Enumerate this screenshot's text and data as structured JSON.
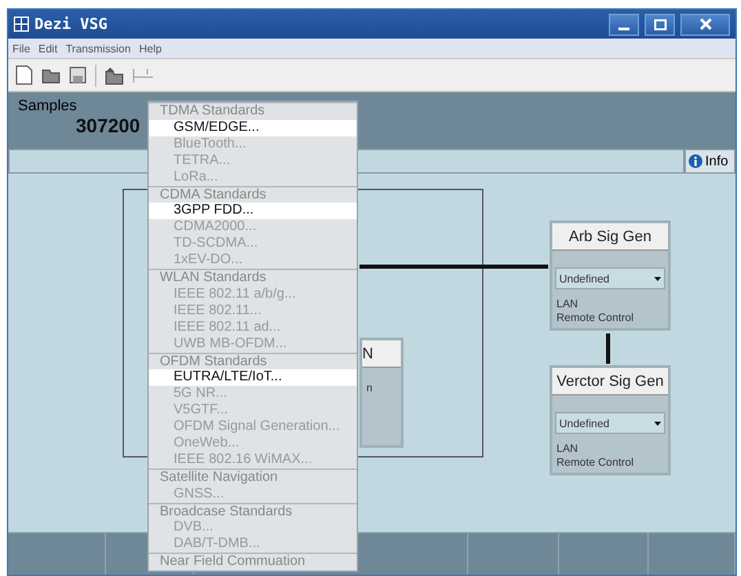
{
  "window": {
    "title": "Dezi VSG"
  },
  "menu_bar": [
    "File",
    "Edit",
    "Transmission",
    "Help"
  ],
  "samples": {
    "label": "Samples",
    "value": "307200"
  },
  "info_button": "Info",
  "partial_block": {
    "title": "N",
    "line": "n"
  },
  "blocks": [
    {
      "title": "Arb Sig Gen",
      "select": "Undefined",
      "lines": [
        "LAN",
        "Remote Control"
      ]
    },
    {
      "title": "Verctor Sig Gen",
      "select": "Undefined",
      "lines": [
        "LAN",
        "Remote Control"
      ]
    }
  ],
  "dropdown_menu": [
    {
      "header": "TDMA Standards",
      "items": [
        {
          "label": "GSM/EDGE...",
          "disabled": false
        },
        {
          "label": "BlueTooth...",
          "disabled": true
        },
        {
          "label": "TETRA...",
          "disabled": true
        },
        {
          "label": "LoRa...",
          "disabled": true
        }
      ]
    },
    {
      "header": "CDMA Standards",
      "items": [
        {
          "label": "3GPP FDD...",
          "disabled": false
        },
        {
          "label": "CDMA2000...",
          "disabled": true
        },
        {
          "label": "TD-SCDMA...",
          "disabled": true
        },
        {
          "label": "1xEV-DO...",
          "disabled": true
        }
      ]
    },
    {
      "header": "WLAN Standards",
      "items": [
        {
          "label": "IEEE 802.11 a/b/g...",
          "disabled": true
        },
        {
          "label": "IEEE 802.11...",
          "disabled": true
        },
        {
          "label": "IEEE 802.11 ad...",
          "disabled": true
        },
        {
          "label": "UWB MB-OFDM...",
          "disabled": true
        }
      ]
    },
    {
      "header": "OFDM Standards",
      "items": [
        {
          "label": "EUTRA/LTE/IoT...",
          "disabled": false
        },
        {
          "label": "5G NR...",
          "disabled": true
        },
        {
          "label": "V5GTF...",
          "disabled": true
        },
        {
          "label": "OFDM Signal Generation...",
          "disabled": true
        },
        {
          "label": "OneWeb...",
          "disabled": true
        },
        {
          "label": "IEEE 802.16 WiMAX...",
          "disabled": true
        }
      ]
    },
    {
      "header": "Satellite Navigation",
      "items": [
        {
          "label": "GNSS...",
          "disabled": true
        }
      ]
    },
    {
      "header": "Broadcase Standards",
      "items": [
        {
          "label": "DVB...",
          "disabled": true
        },
        {
          "label": "DAB/T-DMB...",
          "disabled": true
        }
      ]
    },
    {
      "header": "Near Field Commuation"
    }
  ]
}
